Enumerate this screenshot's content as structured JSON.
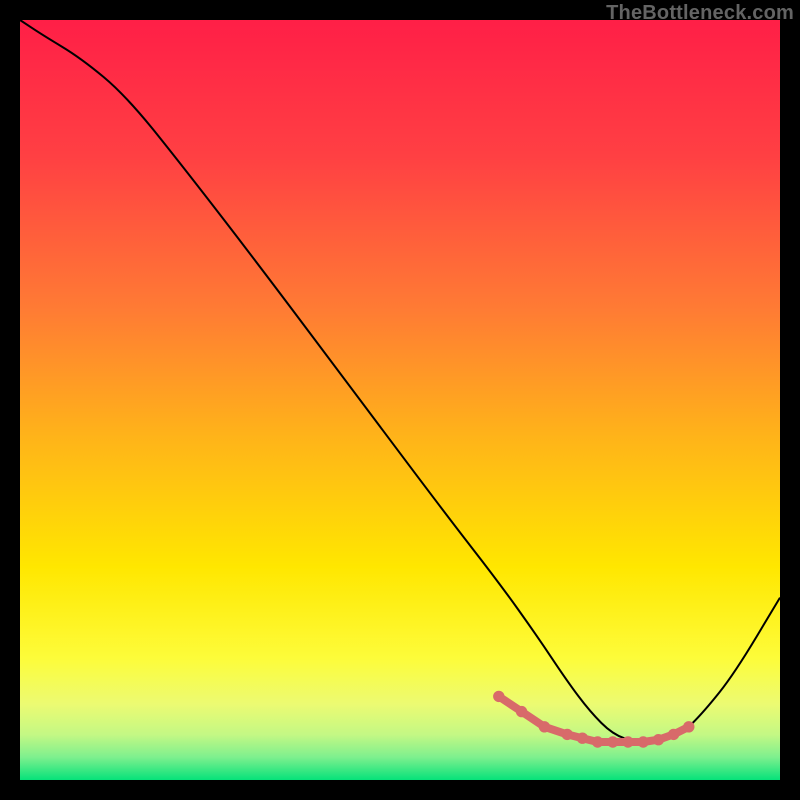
{
  "watermark": "TheBottleneck.com",
  "chart_data": {
    "type": "line",
    "title": "",
    "xlabel": "",
    "ylabel": "",
    "xlim": [
      0,
      100
    ],
    "ylim": [
      0,
      100
    ],
    "grid": false,
    "legend": false,
    "background_gradient_stops": [
      {
        "offset": 0.0,
        "color": "#ff1f47"
      },
      {
        "offset": 0.18,
        "color": "#ff4043"
      },
      {
        "offset": 0.38,
        "color": "#ff7b34"
      },
      {
        "offset": 0.55,
        "color": "#ffb419"
      },
      {
        "offset": 0.72,
        "color": "#ffe700"
      },
      {
        "offset": 0.84,
        "color": "#fdfc3a"
      },
      {
        "offset": 0.9,
        "color": "#ecfb72"
      },
      {
        "offset": 0.94,
        "color": "#c4f884"
      },
      {
        "offset": 0.97,
        "color": "#7ef08e"
      },
      {
        "offset": 1.0,
        "color": "#06e27a"
      }
    ],
    "axes_visible": false,
    "series": [
      {
        "name": "bottleneck-curve",
        "color": "#000000",
        "stroke_width": 2,
        "x": [
          0,
          3,
          8,
          14,
          22,
          32,
          44,
          56,
          63,
          68,
          72,
          75,
          78,
          81,
          84,
          87,
          90,
          94,
          100
        ],
        "y": [
          100,
          98,
          95,
          90,
          80,
          67,
          51,
          35,
          26,
          19,
          13,
          9,
          6,
          5,
          5,
          6,
          9,
          14,
          24
        ]
      }
    ],
    "highlight": {
      "name": "optimal-range-marker",
      "color": "#d86a6a",
      "stroke_width": 8,
      "x": [
        63,
        66,
        69,
        72,
        74,
        76,
        78,
        80,
        82,
        84,
        86,
        88
      ],
      "y": [
        11,
        9,
        7,
        6,
        5.5,
        5,
        5,
        5,
        5,
        5.3,
        6,
        7
      ]
    }
  }
}
